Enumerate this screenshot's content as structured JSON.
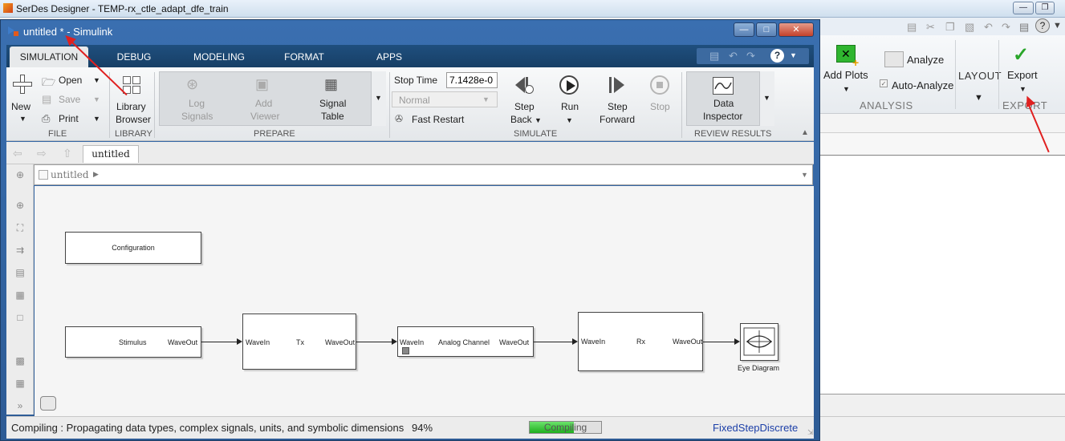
{
  "background_window": {
    "title": "SerDes Designer - TEMP-rx_ctle_adapt_dfe_train",
    "ribbon": {
      "add_plots": "Add Plots",
      "analyze": "Analyze",
      "auto_analyze": "Auto-Analyze",
      "layout": "LAYOUT",
      "export": "Export",
      "section_analysis": "ANALYSIS",
      "section_export": "EXPORT"
    }
  },
  "simulink": {
    "title": "untitled * - Simulink",
    "tabs": [
      "SIMULATION",
      "DEBUG",
      "MODELING",
      "FORMAT",
      "APPS"
    ],
    "file": {
      "new": "New",
      "open": "Open",
      "save": "Save",
      "print": "Print",
      "section": "FILE"
    },
    "library": {
      "label_line1": "Library",
      "label_line2": "Browser",
      "section": "LIBRARY"
    },
    "prepare": {
      "log_signals_1": "Log",
      "log_signals_2": "Signals",
      "add_viewer_1": "Add",
      "add_viewer_2": "Viewer",
      "signal_table_1": "Signal",
      "signal_table_2": "Table",
      "section": "PREPARE"
    },
    "simulate": {
      "stop_time_label": "Stop Time",
      "stop_time_value": "7.1428e-0",
      "mode": "Normal",
      "fast_restart": "Fast Restart",
      "step_back_1": "Step",
      "step_back_2": "Back",
      "run": "Run",
      "step_forward_1": "Step",
      "step_forward_2": "Forward",
      "stop": "Stop",
      "section": "SIMULATE"
    },
    "review": {
      "data_inspector_1": "Data",
      "data_inspector_2": "Inspector",
      "section": "REVIEW RESULTS"
    },
    "nav_tab": "untitled",
    "address": "untitled",
    "blocks": {
      "configuration": "Configuration",
      "stimulus": "Stimulus",
      "stimulus_out": "WaveOut",
      "tx": "Tx",
      "tx_in": "WaveIn",
      "tx_out": "WaveOut",
      "channel": "Analog Channel",
      "channel_in": "WaveIn",
      "channel_out": "WaveOut",
      "rx": "Rx",
      "rx_in": "WaveIn",
      "rx_out": "WaveOut",
      "eye": "Eye Diagram"
    },
    "status": {
      "message": "Compiling : Propagating data types, complex signals, units, and symbolic dimensions",
      "percent": "94%",
      "progress_label": "Compiling",
      "progress_fraction": 0.62,
      "solver": "FixedStepDiscrete"
    }
  },
  "colors": {
    "simulink_frame": "#2d5b95",
    "tab_bar": "#1f4f7e",
    "annotation_arrow": "#e02020",
    "solver_link": "#1c3fa8",
    "progress_green": "#1fae1f"
  }
}
